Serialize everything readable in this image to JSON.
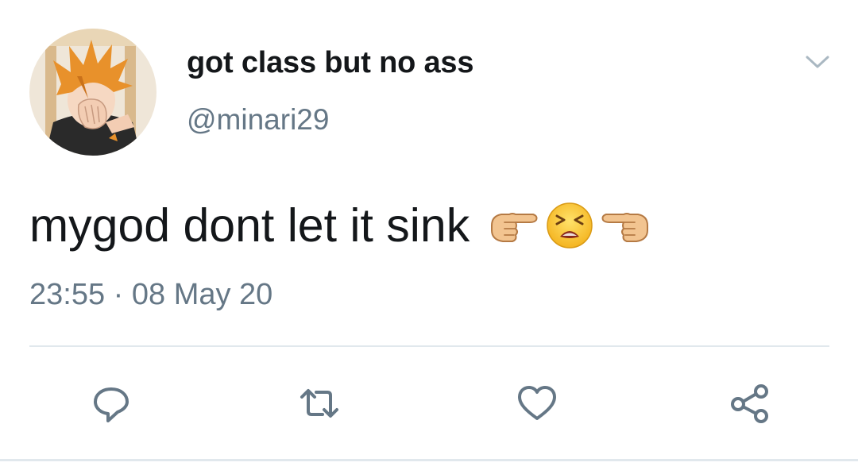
{
  "tweet": {
    "display_name": "got class but no ass",
    "handle": "@minari29",
    "text": "mygod dont let it sink",
    "emojis": [
      "backhand-index-pointing-right",
      "tired-face",
      "backhand-index-pointing-left"
    ],
    "timestamp": "23:55 · 08 May 20"
  },
  "actions": {
    "icons": [
      "reply-icon",
      "retweet-icon",
      "like-icon",
      "share-icon"
    ]
  },
  "colors": {
    "text_primary": "#14171a",
    "text_secondary": "#657786",
    "icon": "#657786",
    "divider": "#e1e8ed",
    "avatar_hair": "#e8912b",
    "avatar_shirt": "#2a2a2a"
  }
}
